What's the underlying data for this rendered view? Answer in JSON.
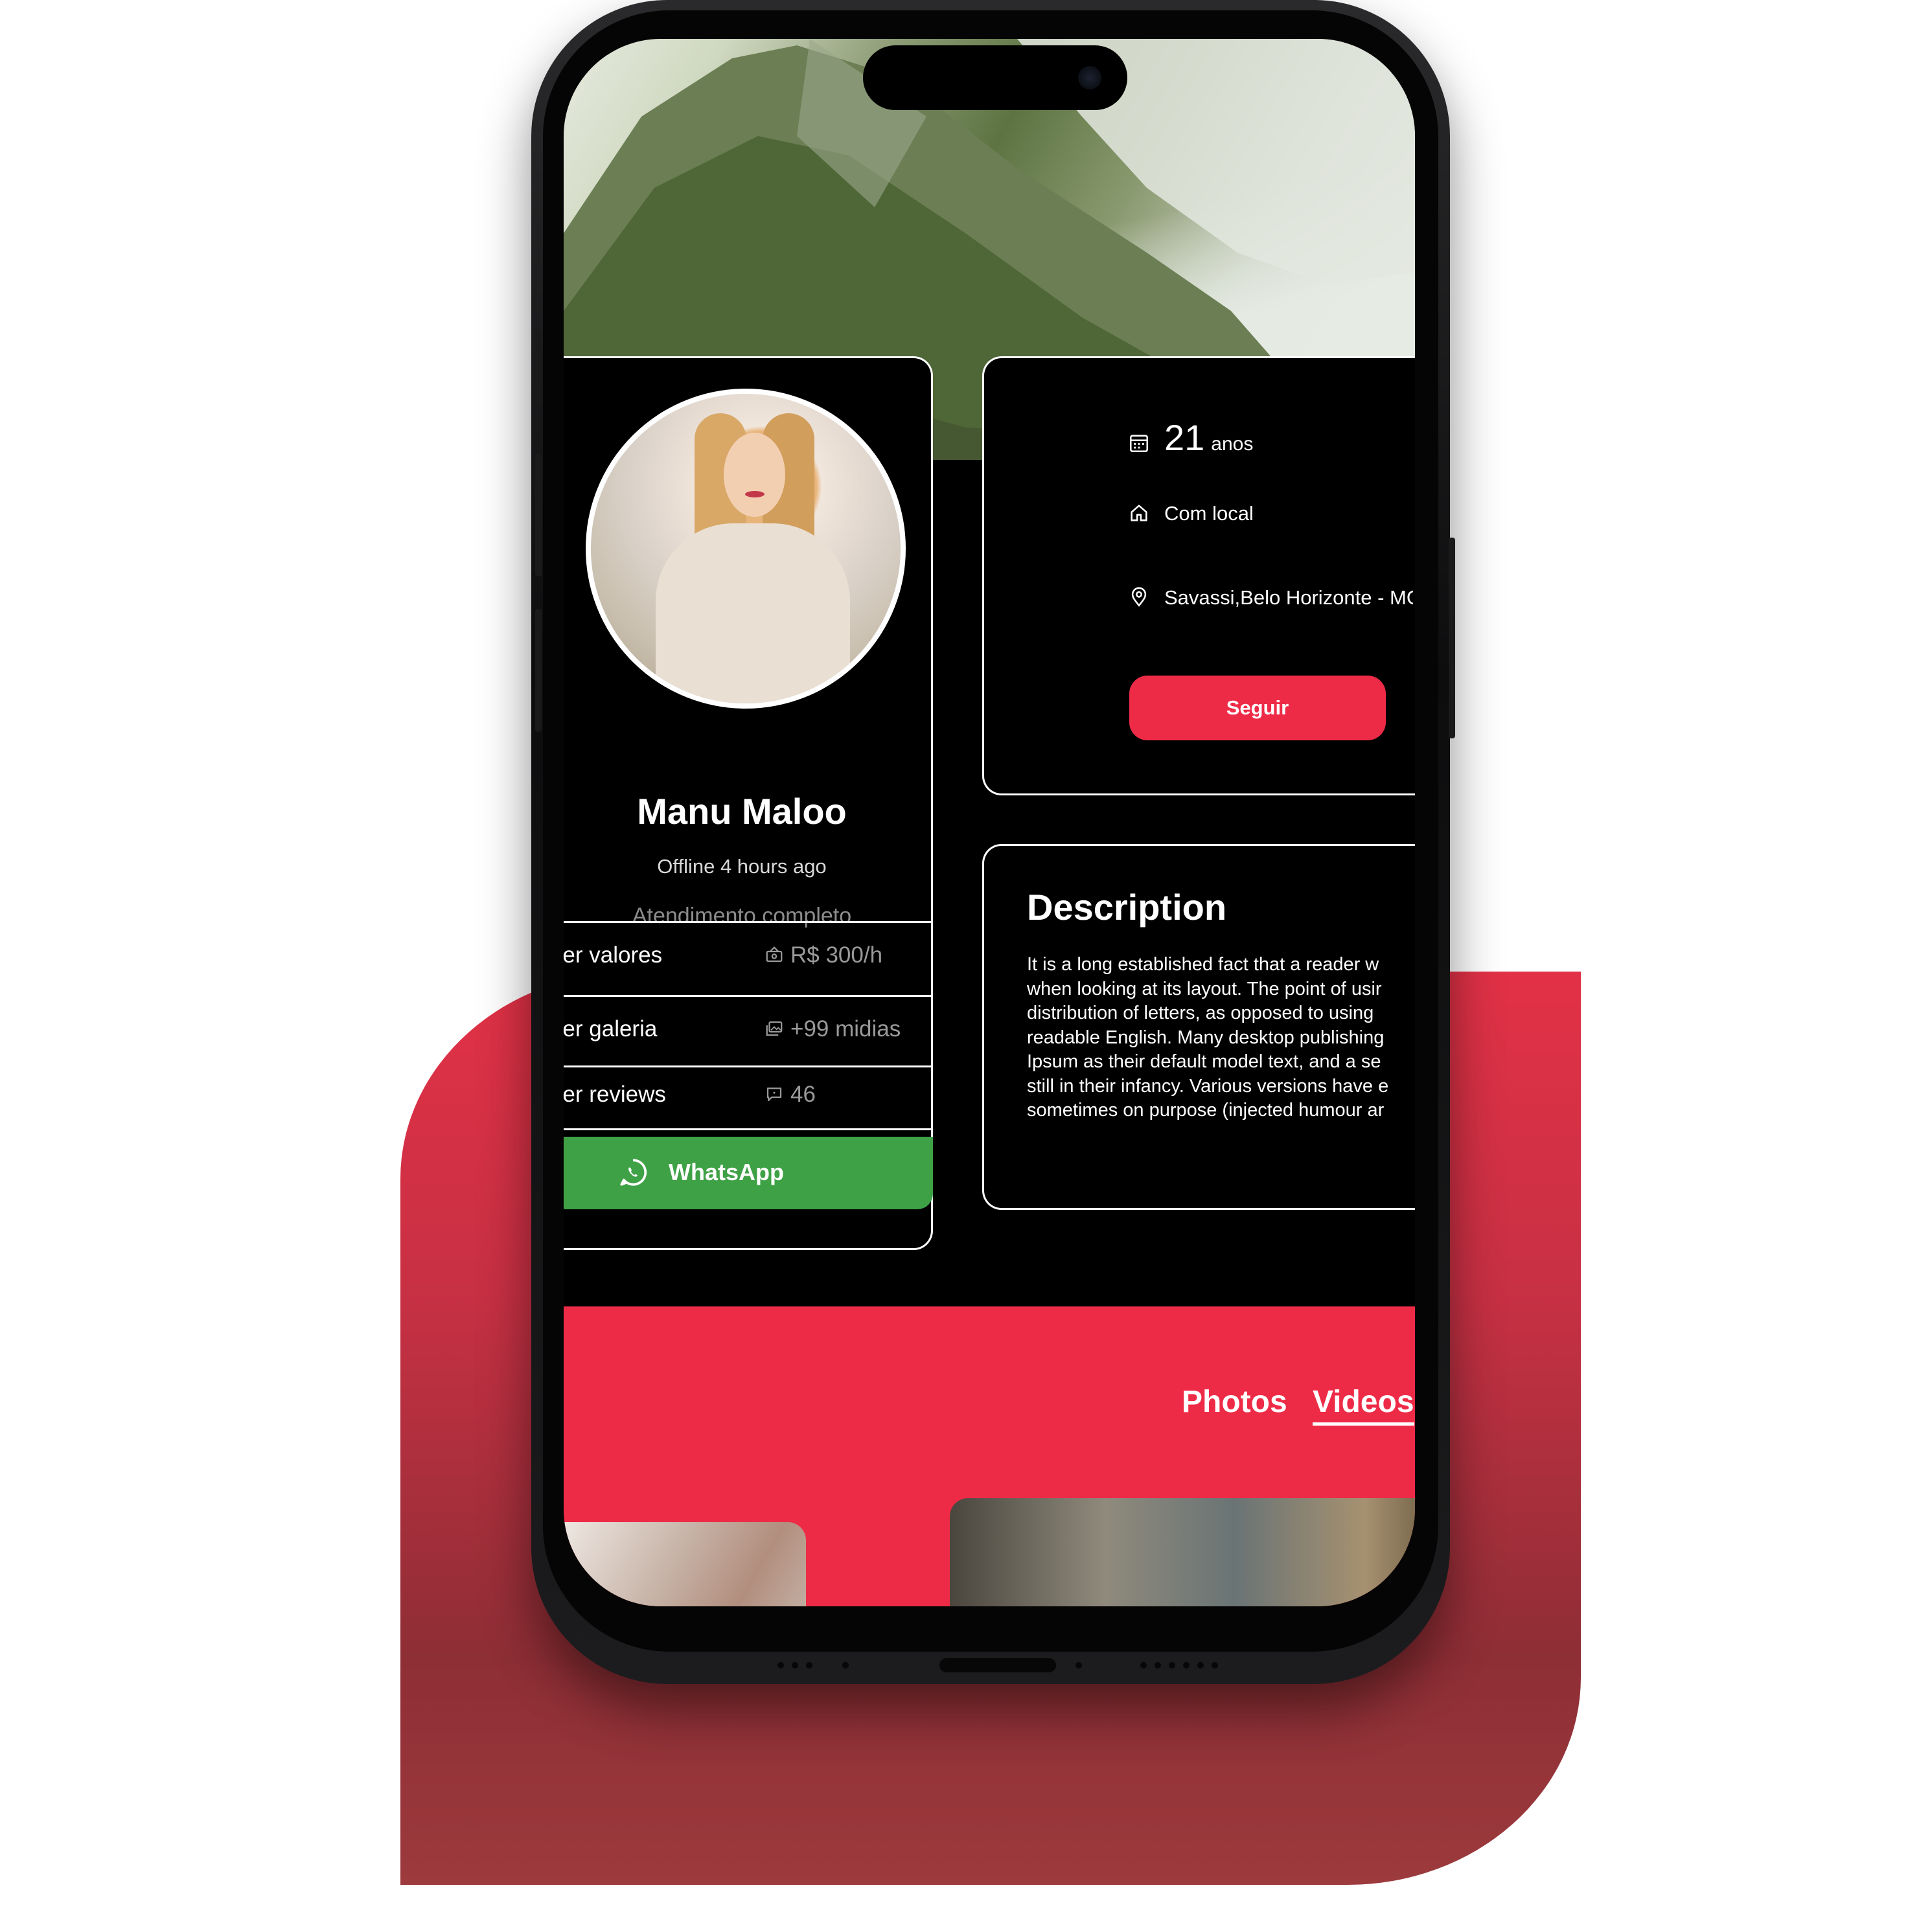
{
  "colors": {
    "accent": "#ee2b47",
    "whatsapp": "#3fa146",
    "card_bg": "#000000",
    "card_border": "#ffffff"
  },
  "profile": {
    "name": "Manu Maloo",
    "status": "Offline 4 hours ago",
    "service": "Atendimento completo"
  },
  "actions": [
    {
      "label": "Ver valores",
      "icon": "cash-icon",
      "value": "R$ 300/h"
    },
    {
      "label": "Ver galeria",
      "icon": "gallery-icon",
      "value": "+99 midias"
    },
    {
      "label": "Ver reviews",
      "icon": "comment-icon",
      "value": "46"
    }
  ],
  "whatsapp": {
    "label": "WhatsApp",
    "icon": "whatsapp-icon"
  },
  "info": {
    "age_value": "21",
    "age_unit": "anos",
    "place": "Com local",
    "location": "Savassi,Belo Horizonte - MG",
    "follow_label": "Seguir"
  },
  "description": {
    "title": "Description",
    "lines": [
      "It is a long established fact that a reader w",
      "when looking at its layout. The point of usir",
      "distribution of letters, as opposed to using",
      "readable English. Many desktop publishing",
      "Ipsum as their default model text, and a se",
      "still in their infancy. Various versions have e",
      "sometimes on purpose (injected humour ar"
    ]
  },
  "tabs": {
    "photos": "Photos",
    "videos": "Videos",
    "active": "Videos"
  }
}
